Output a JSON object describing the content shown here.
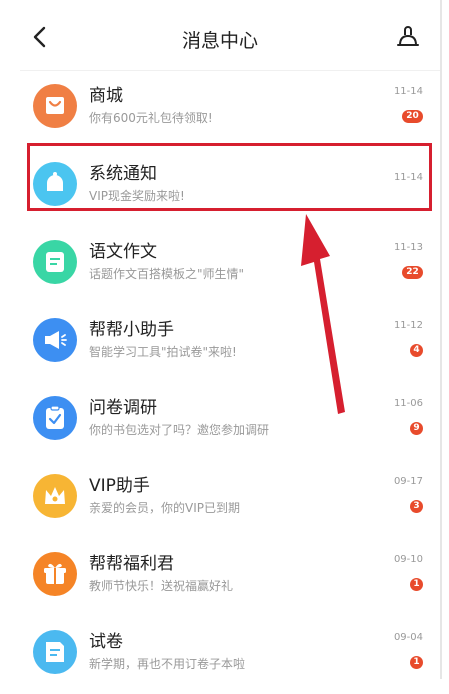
{
  "header": {
    "title": "消息中心"
  },
  "messages": [
    {
      "name": "商城",
      "preview": "你有600元礼包待领取!",
      "time": "11-14",
      "badge": "20",
      "color": "#f07f44",
      "icon": "shopping-bag-icon"
    },
    {
      "name": "系统通知",
      "preview": "VIP现金奖励来啦!",
      "time": "11-14",
      "badge": "",
      "color": "#4bc5f0",
      "icon": "bell-icon"
    },
    {
      "name": "语文作文",
      "preview": "话题作文百搭模板之\"师生情\"",
      "time": "11-13",
      "badge": "22",
      "color": "#39d6a5",
      "icon": "document-icon"
    },
    {
      "name": "帮帮小助手",
      "preview": "智能学习工具\"拍试卷\"来啦!",
      "time": "11-12",
      "badge": "4",
      "color": "#3d8ff2",
      "icon": "megaphone-icon"
    },
    {
      "name": "问卷调研",
      "preview": "你的书包选对了吗？邀您参加调研",
      "time": "11-06",
      "badge": "9",
      "color": "#3d8ff2",
      "icon": "clipboard-icon"
    },
    {
      "name": "VIP助手",
      "preview": "亲爱的会员，你的VIP已到期",
      "time": "09-17",
      "badge": "3",
      "color": "#f7b534",
      "icon": "crown-icon"
    },
    {
      "name": "帮帮福利君",
      "preview": "教师节快乐！送祝福赢好礼",
      "time": "09-10",
      "badge": "1",
      "color": "#f58426",
      "icon": "gift-icon"
    },
    {
      "name": "试卷",
      "preview": "新学期，再也不用订卷子本啦",
      "time": "09-04",
      "badge": "1",
      "color": "#4bb9f0",
      "icon": "exam-paper-icon"
    }
  ]
}
